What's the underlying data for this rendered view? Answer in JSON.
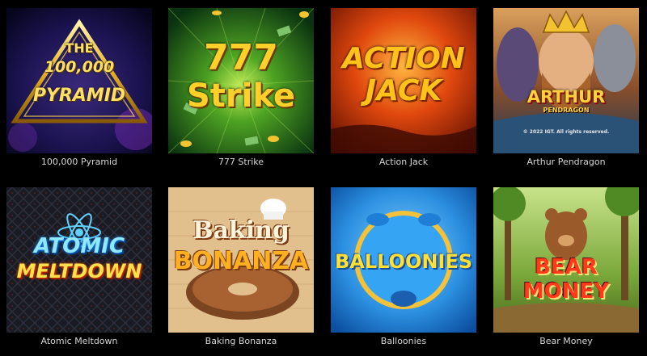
{
  "games": [
    {
      "name": "100,000 Pyramid",
      "logo_lines": [
        "THE",
        "100,000",
        "PYRAMID"
      ]
    },
    {
      "name": "777 Strike",
      "logo_lines": [
        "777",
        "Strike"
      ]
    },
    {
      "name": "Action Jack",
      "logo_lines": [
        "ACTION",
        "JACK"
      ]
    },
    {
      "name": "Arthur Pendragon",
      "logo_lines": [
        "ARTHUR",
        "PENDRAGON"
      ],
      "copyright": "© 2022 IGT. All rights reserved."
    },
    {
      "name": "Atomic Meltdown",
      "logo_lines": [
        "ATOMIC",
        "MELTDOWN"
      ]
    },
    {
      "name": "Baking Bonanza",
      "logo_lines": [
        "Baking",
        "BONANZA"
      ]
    },
    {
      "name": "Balloonies",
      "logo_lines": [
        "BALLOONIES"
      ]
    },
    {
      "name": "Bear Money",
      "logo_lines": [
        "BEAR",
        "MONEY"
      ]
    }
  ],
  "colors": {
    "page_background": "#000000",
    "caption_text": "#d6d6d6"
  }
}
